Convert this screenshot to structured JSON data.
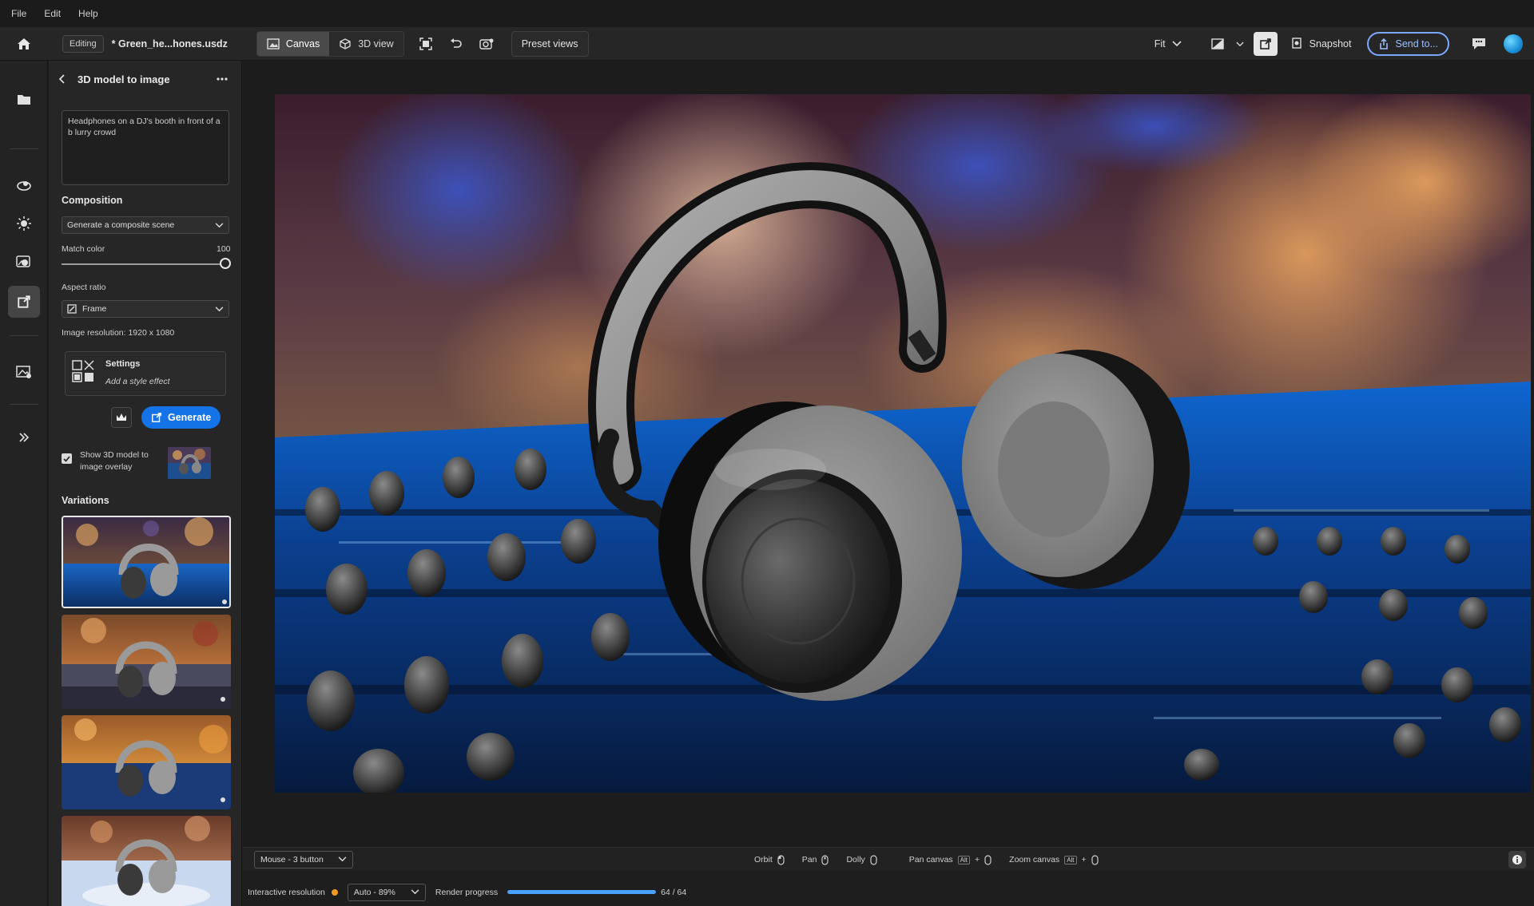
{
  "menu": {
    "items": [
      "File",
      "Edit",
      "Help"
    ]
  },
  "toolbar": {
    "editing_badge": "Editing",
    "document_title": "* Green_he...hones.usdz",
    "canvas_label": "Canvas",
    "view3d_label": "3D view",
    "preset_views_label": "Preset views",
    "fit_label": "Fit",
    "snapshot_label": "Snapshot",
    "send_to_label": "Send to..."
  },
  "panel": {
    "title": "3D model to image",
    "prompt": "Headphones on a DJ's booth in front of a b lurry crowd",
    "composition_label": "Composition",
    "composition_value": "Generate a composite scene",
    "match_color_label": "Match color",
    "match_color_value": "100",
    "match_color_fraction": 1.0,
    "aspect_ratio_label": "Aspect ratio",
    "aspect_ratio_value": "Frame",
    "image_resolution": "Image resolution: 1920 x 1080",
    "settings_title": "Settings",
    "settings_subtitle": "Add a style effect",
    "generate_label": "Generate",
    "overlay_label": "Show 3D model to image overlay",
    "overlay_checked": true,
    "variations_label": "Variations"
  },
  "bottom": {
    "mouse_mode": "Mouse - 3 button",
    "orbit": "Orbit",
    "pan": "Pan",
    "dolly": "Dolly",
    "pan_canvas": "Pan canvas",
    "zoom_canvas": "Zoom canvas",
    "alt_key": "Alt",
    "plus": "+",
    "interactive_resolution_label": "Interactive resolution",
    "interactive_resolution_value": "Auto - 89%",
    "render_progress_label": "Render progress",
    "render_progress_text": "64 / 64",
    "render_progress_fraction": 1.0
  },
  "colors": {
    "accent": "#1473e6",
    "send_to_border": "#7aa9ff",
    "status_dot": "#f39b22",
    "progress": "#4aa0ff"
  }
}
